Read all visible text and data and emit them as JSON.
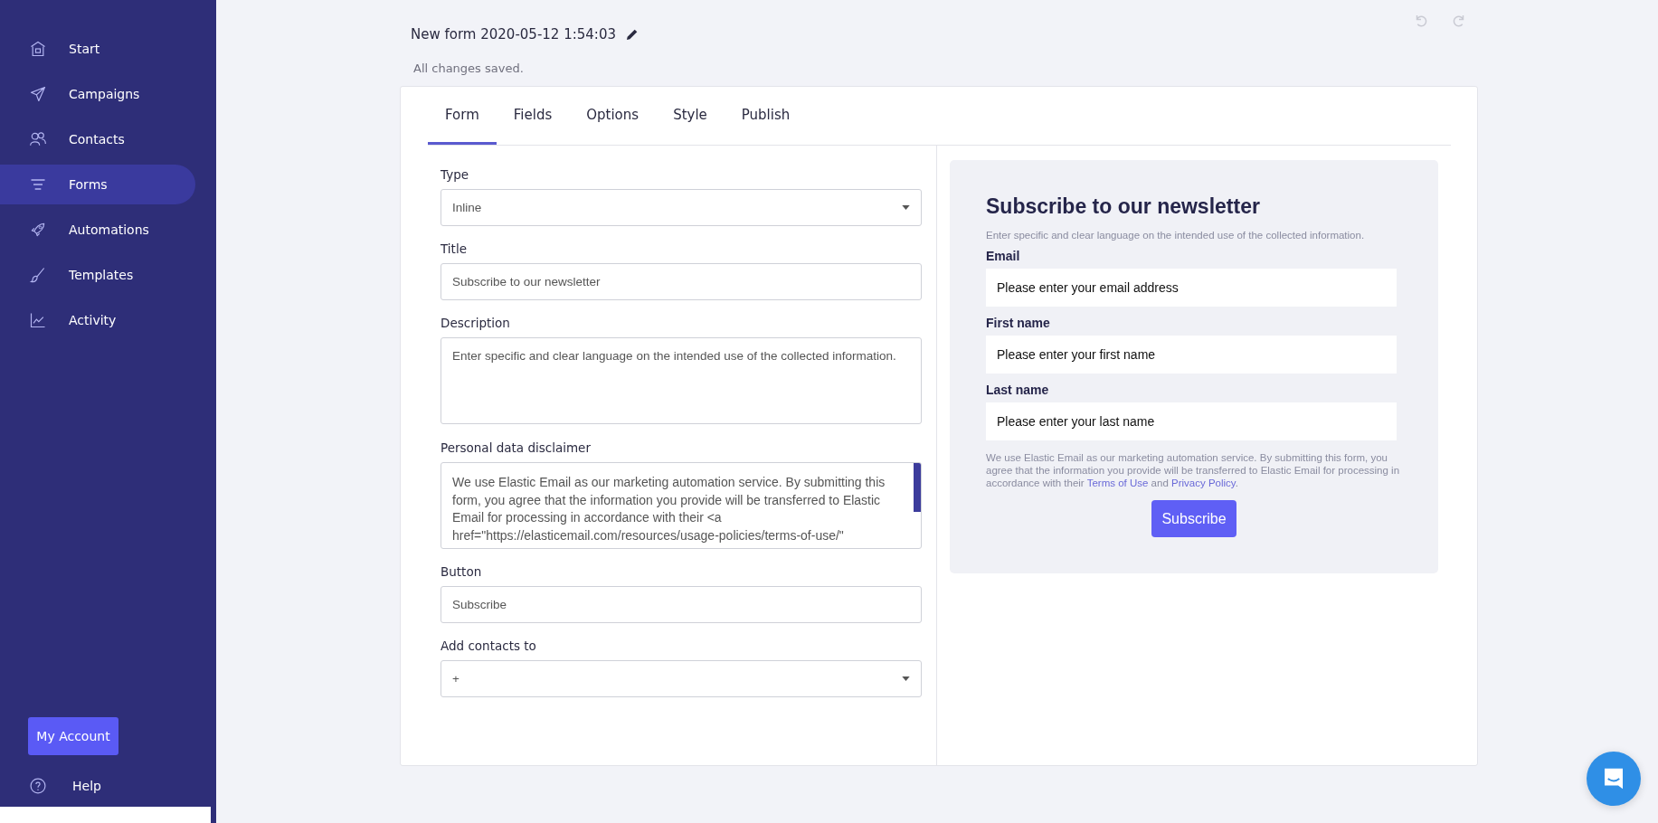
{
  "sidebar": {
    "items": [
      {
        "label": "Start",
        "selected": false
      },
      {
        "label": "Campaigns",
        "selected": false
      },
      {
        "label": "Contacts",
        "selected": false
      },
      {
        "label": "Forms",
        "selected": true
      },
      {
        "label": "Automations",
        "selected": false
      },
      {
        "label": "Templates",
        "selected": false
      },
      {
        "label": "Activity",
        "selected": false
      }
    ],
    "account_button": "My Account",
    "help": "Help"
  },
  "header": {
    "title": "New form 2020-05-12 1:54:03",
    "status": "All changes saved."
  },
  "tabs": [
    {
      "label": "Form",
      "selected": true
    },
    {
      "label": "Fields",
      "selected": false
    },
    {
      "label": "Options",
      "selected": false
    },
    {
      "label": "Style",
      "selected": false
    },
    {
      "label": "Publish",
      "selected": false
    }
  ],
  "settings": [
    {
      "kind": "select",
      "label": "Type",
      "value": "Inline"
    },
    {
      "kind": "input",
      "label": "Title",
      "value": "Subscribe to our newsletter"
    },
    {
      "kind": "textarea",
      "label": "Description",
      "value": "Enter specific and clear language on the intended use of the collected information."
    },
    {
      "kind": "scrolltext",
      "label": "Personal data disclaimer",
      "lines": [
        "We use Elastic Email as our marketing automation service. By submitting this",
        "form, you agree that the information you provide will be transferred to Elastic",
        "Email for processing in accordance with their <a",
        "href=\"https://elasticemail.com/resources/usage-policies/terms-of-use/\""
      ]
    },
    {
      "kind": "input",
      "label": "Button",
      "value": "Subscribe"
    },
    {
      "kind": "select",
      "label": "Add contacts to",
      "value": "+"
    }
  ],
  "preview": {
    "title": "Subscribe to our newsletter",
    "description": "Enter specific and clear language on the intended use of the collected information.",
    "fields": [
      {
        "label": "Email",
        "placeholder": "Please enter your email address"
      },
      {
        "label": "First name",
        "placeholder": "Please enter your first name"
      },
      {
        "label": "Last name",
        "placeholder": "Please enter your last name"
      }
    ],
    "disclaimer": {
      "before": "We use Elastic Email as our marketing automation service. By submitting this form, you agree that the information you provide will be transferred to Elastic Email for processing in accordance with their ",
      "terms_link": "Terms of Use",
      "middle": " and ",
      "privacy_link": "Privacy Policy",
      "after": "."
    },
    "button": "Subscribe"
  }
}
